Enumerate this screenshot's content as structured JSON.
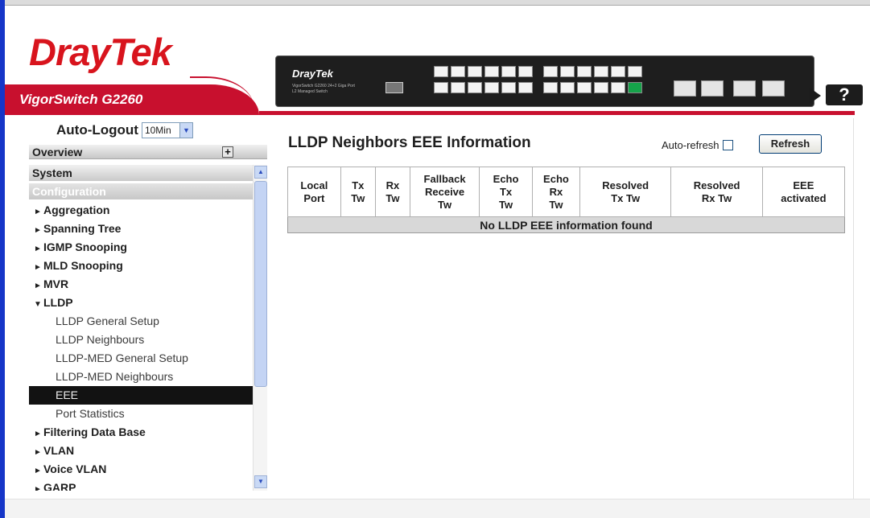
{
  "brand": {
    "logo_part1": "Dray",
    "logo_part2": "Tek",
    "model": "VigorSwitch G2260",
    "device_brand": "DrayTek",
    "device_sub": "VigorSwitch G2260 24+2 Giga Port L2 Managed Switch",
    "help_label": "?"
  },
  "sidebar": {
    "auto_logout_label": "Auto-Logout",
    "auto_logout_value": "10Min",
    "overview": "Overview",
    "system": "System",
    "configuration": "Configuration",
    "items": [
      {
        "label": "Aggregation",
        "arrow": "►",
        "level": "top"
      },
      {
        "label": "Spanning Tree",
        "arrow": "►",
        "level": "top"
      },
      {
        "label": "IGMP Snooping",
        "arrow": "►",
        "level": "top"
      },
      {
        "label": "MLD Snooping",
        "arrow": "►",
        "level": "top"
      },
      {
        "label": "MVR",
        "arrow": "►",
        "level": "top"
      },
      {
        "label": "LLDP",
        "arrow": "▼",
        "level": "top"
      },
      {
        "label": "LLDP General Setup",
        "level": "sub"
      },
      {
        "label": "LLDP Neighbours",
        "level": "sub"
      },
      {
        "label": "LLDP-MED General Setup",
        "level": "sub"
      },
      {
        "label": "LLDP-MED Neighbours",
        "level": "sub"
      },
      {
        "label": "EEE",
        "level": "sub",
        "active": true
      },
      {
        "label": "Port Statistics",
        "level": "sub"
      },
      {
        "label": "Filtering Data Base",
        "arrow": "►",
        "level": "top"
      },
      {
        "label": "VLAN",
        "arrow": "►",
        "level": "top"
      },
      {
        "label": "Voice VLAN",
        "arrow": "►",
        "level": "top"
      },
      {
        "label": "GARP",
        "arrow": "►",
        "level": "top"
      }
    ]
  },
  "main": {
    "title": "LLDP Neighbors EEE Information",
    "auto_refresh_label": "Auto-refresh",
    "auto_refresh_checked": false,
    "refresh_button": "Refresh",
    "columns": [
      [
        "Local",
        "Port"
      ],
      [
        "Tx",
        "Tw"
      ],
      [
        "Rx",
        "Tw"
      ],
      [
        "Fallback",
        "Receive",
        "Tw"
      ],
      [
        "Echo",
        "Tx",
        "Tw"
      ],
      [
        "Echo",
        "Rx",
        "Tw"
      ],
      [
        "Resolved",
        "Tx Tw"
      ],
      [
        "Resolved",
        "Rx Tw"
      ],
      [
        "EEE",
        "activated"
      ]
    ],
    "empty_message": "No LLDP EEE information found"
  },
  "colors": {
    "accent_red": "#c8102e",
    "left_accent_blue": "#1636c8",
    "active_item_bg": "#121212"
  }
}
